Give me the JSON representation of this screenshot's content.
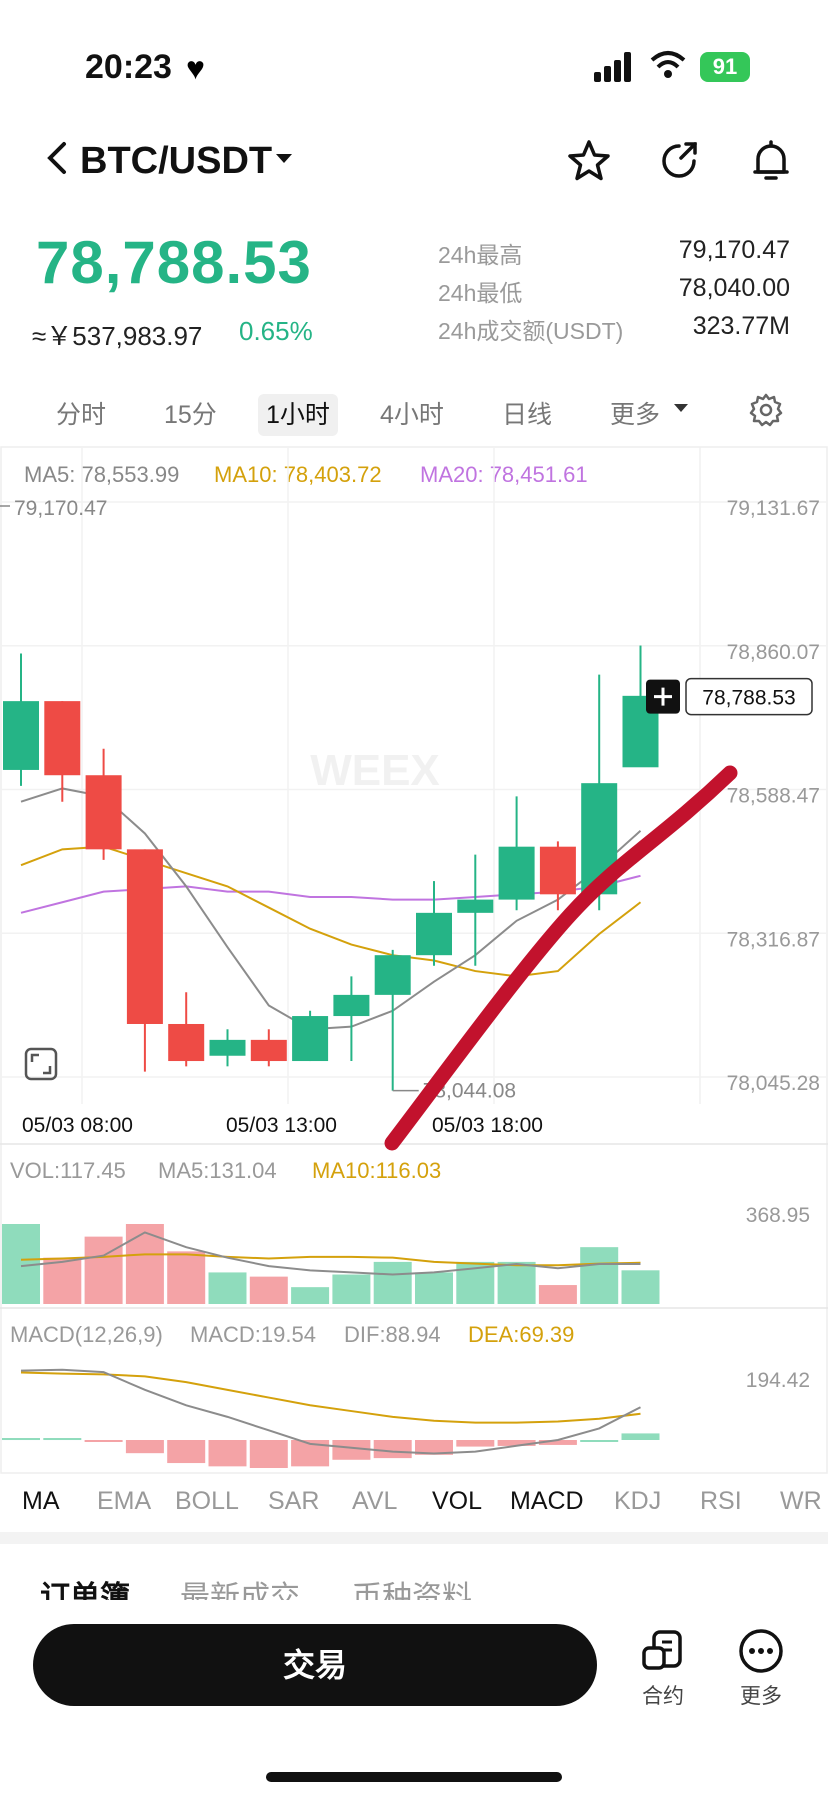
{
  "status_bar": {
    "time": "20:23",
    "battery": "91"
  },
  "header": {
    "pair": "BTC/USDT"
  },
  "ticker": {
    "price": "78,788.53",
    "cny": "≈￥537,983.97",
    "change": "0.65%",
    "stats": [
      {
        "label": "24h最高",
        "value": "79,170.47"
      },
      {
        "label": "24h最低",
        "value": "78,040.00"
      },
      {
        "label": "24h成交额(USDT)",
        "value": "323.77M"
      }
    ]
  },
  "intervals": [
    "分时",
    "15分",
    "1小时",
    "4小时",
    "日线",
    "更多"
  ],
  "active_interval": "1小时",
  "colors": {
    "up": "#25b486",
    "down": "#ee4b45",
    "ma5": "#8c8c8c",
    "ma10": "#d4a10c",
    "ma20": "#c074e0",
    "vol_up": "#8fdcbc",
    "vol_down": "#f4a3a6"
  },
  "chart_data": [
    {
      "type": "candlestick",
      "indicators": {
        "ma5_label": "MA5: 78,553.99",
        "ma10_label": "MA10: 78,403.72",
        "ma20_label": "MA20: 78,451.61"
      },
      "y_ticks": [
        "79,131.67",
        "78,860.07",
        "78,588.47",
        "78,316.87",
        "78,045.28"
      ],
      "ylim": [
        78045.28,
        79131.67
      ],
      "x_ticks": [
        "05/03 08:00",
        "05/03 13:00",
        "05/03 18:00"
      ],
      "high_label": "79,170.47",
      "low_label": "78,044.08",
      "current_price_tag": "78,788.53",
      "watermark": "WEEX",
      "candles": [
        {
          "o": 78650,
          "c": 78780,
          "h": 78870,
          "l": 78620
        },
        {
          "o": 78780,
          "c": 78640,
          "h": 78780,
          "l": 78590
        },
        {
          "o": 78640,
          "c": 78500,
          "h": 78690,
          "l": 78480
        },
        {
          "o": 78500,
          "c": 78170,
          "h": 78500,
          "l": 78080
        },
        {
          "o": 78170,
          "c": 78100,
          "h": 78230,
          "l": 78090
        },
        {
          "o": 78110,
          "c": 78140,
          "h": 78160,
          "l": 78090
        },
        {
          "o": 78140,
          "c": 78100,
          "h": 78160,
          "l": 78090
        },
        {
          "o": 78100,
          "c": 78185,
          "h": 78195,
          "l": 78100
        },
        {
          "o": 78185,
          "c": 78225,
          "h": 78260,
          "l": 78100
        },
        {
          "o": 78225,
          "c": 78300,
          "h": 78310,
          "l": 78044
        },
        {
          "o": 78300,
          "c": 78380,
          "h": 78440,
          "l": 78280
        },
        {
          "o": 78380,
          "c": 78405,
          "h": 78490,
          "l": 78280
        },
        {
          "o": 78405,
          "c": 78505,
          "h": 78600,
          "l": 78385
        },
        {
          "o": 78505,
          "c": 78415,
          "h": 78515,
          "l": 78385
        },
        {
          "o": 78415,
          "c": 78625,
          "h": 78830,
          "l": 78385
        },
        {
          "o": 78655,
          "c": 78790,
          "h": 78885,
          "l": 78780
        }
      ],
      "ma5": [
        78590,
        78615,
        78600,
        78530,
        78430,
        78315,
        78205,
        78160,
        78165,
        78195,
        78250,
        78300,
        78365,
        78405,
        78465,
        78535
      ],
      "ma10": [
        78470,
        78500,
        78505,
        78480,
        78455,
        78430,
        78390,
        78350,
        78320,
        78300,
        78290,
        78270,
        78260,
        78270,
        78340,
        78400
      ],
      "ma20": [
        78380,
        78400,
        78420,
        78425,
        78430,
        78420,
        78420,
        78410,
        78410,
        78405,
        78405,
        78410,
        78415,
        78420,
        78430,
        78450
      ]
    },
    {
      "type": "bar",
      "label_vol": "VOL:117.45",
      "label_ma5": "MA5:131.04",
      "label_ma10": "MA10:116.03",
      "y_tick": "368.95",
      "ylim": [
        0,
        368.95
      ],
      "values": [
        190,
        110,
        160,
        190,
        125,
        75,
        65,
        40,
        70,
        100,
        75,
        100,
        100,
        45,
        135,
        80
      ],
      "ma5": [
        90,
        100,
        115,
        170,
        135,
        110,
        90,
        80,
        75,
        70,
        75,
        85,
        95,
        85,
        95,
        95
      ],
      "ma10": [
        105,
        108,
        112,
        118,
        118,
        112,
        108,
        112,
        112,
        110,
        100,
        96,
        92,
        92,
        96,
        98
      ]
    },
    {
      "type": "bar",
      "label_macd": "MACD(12,26,9)",
      "label_value": "MACD:19.54",
      "label_dif": "DIF:88.94",
      "label_dea": "DEA:69.39",
      "y_tick": "194.42",
      "ylim": [
        -150,
        194.42
      ],
      "hist": [
        6,
        6,
        -6,
        -40,
        -70,
        -80,
        -85,
        -80,
        -60,
        -55,
        -45,
        -20,
        -18,
        -15,
        0,
        20
      ],
      "dif": [
        180,
        182,
        176,
        130,
        90,
        60,
        25,
        -10,
        -20,
        -30,
        -35,
        -30,
        -15,
        0,
        30,
        85
      ],
      "dea": [
        175,
        172,
        170,
        165,
        150,
        130,
        110,
        90,
        75,
        60,
        50,
        45,
        45,
        48,
        55,
        68
      ]
    }
  ],
  "indicator_tabs": [
    "MA",
    "EMA",
    "BOLL",
    "SAR",
    "AVL",
    "VOL",
    "MACD",
    "KDJ",
    "RSI",
    "WR"
  ],
  "order_tabs": [
    "订单簿",
    "最新成交",
    "币种资料"
  ],
  "bottom": {
    "trade": "交易",
    "contract": "合约",
    "more": "更多"
  }
}
